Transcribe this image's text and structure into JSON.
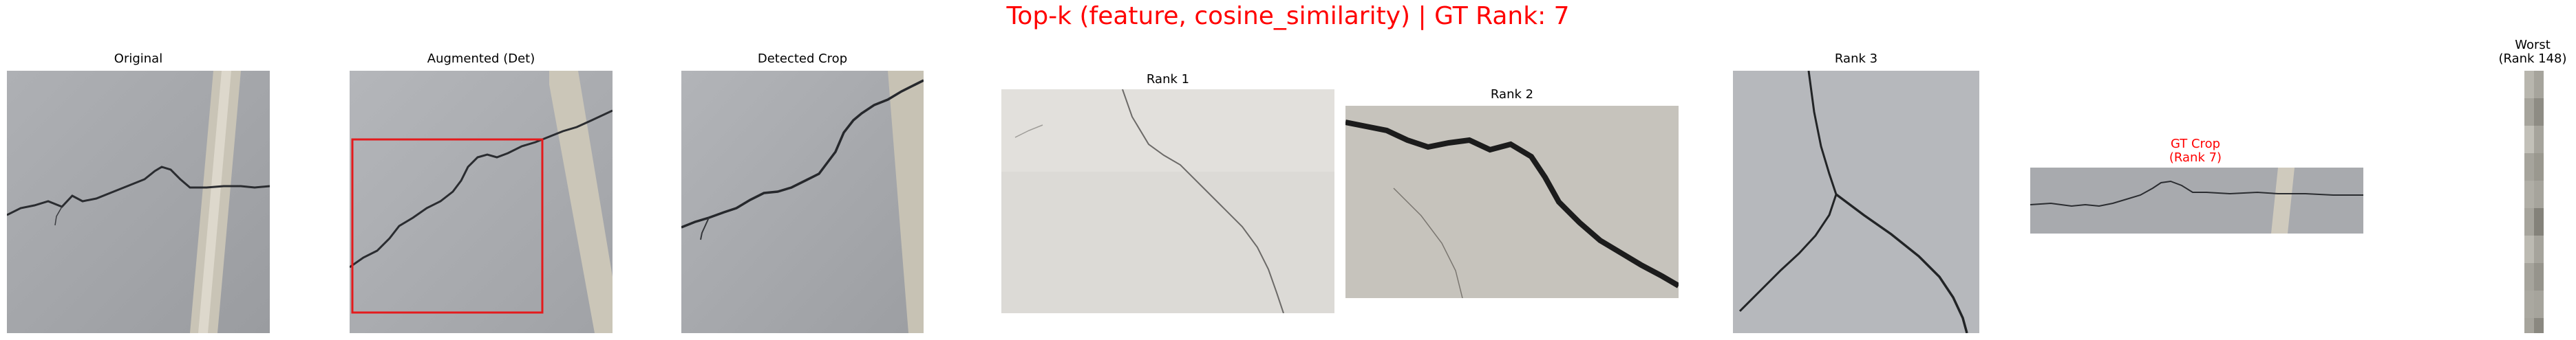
{
  "figure": {
    "title": "Top-k (feature, cosine_similarity) | GT Rank: 7",
    "title_color": "#ff0000"
  },
  "panels": {
    "original": {
      "caption": "Original"
    },
    "augmented": {
      "caption": "Augmented (Det)",
      "box_color": "#e41a1c"
    },
    "detected": {
      "caption": "Detected Crop"
    },
    "rank1": {
      "caption": "Rank 1"
    },
    "rank2": {
      "caption": "Rank 2"
    },
    "rank3": {
      "caption": "Rank 3"
    },
    "gt_crop": {
      "line1": "GT Crop",
      "line2": "(Rank 7)",
      "caption_color": "#ff0000"
    },
    "worst": {
      "line1": "Worst",
      "line2": "(Rank 148)"
    }
  },
  "icons": {
    "crack-image": "photo of cracked concrete wall",
    "detection-box": "red rectangle bounding box"
  }
}
